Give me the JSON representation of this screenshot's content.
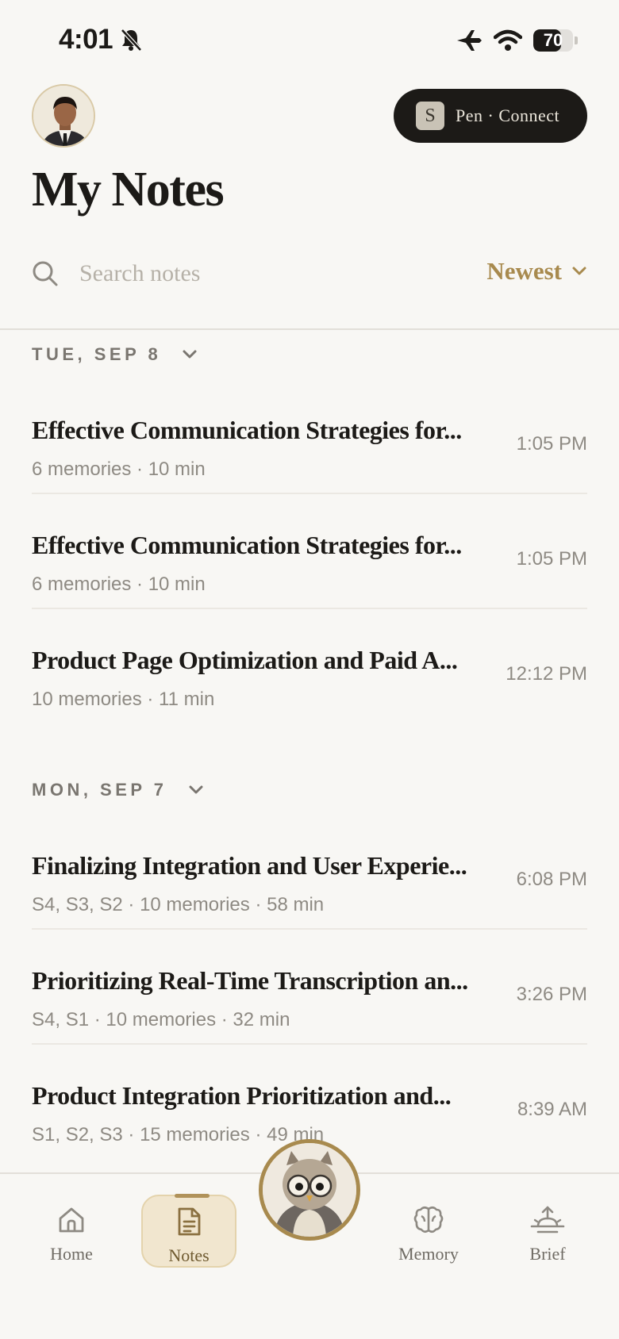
{
  "status_bar": {
    "time": "4:01",
    "battery": "70",
    "battery_level": 0.7
  },
  "header": {
    "pen_badge": "S",
    "pen_label": "Pen · Connect",
    "title": "My Notes"
  },
  "search": {
    "placeholder": "Search notes",
    "value": "",
    "sort_label": "Newest"
  },
  "groups": [
    {
      "date": "TUE, SEP 8",
      "notes": [
        {
          "title": "Effective Communication Strategies for...",
          "meta": "6 memories · 10 min",
          "time": "1:05 PM"
        },
        {
          "title": "Effective Communication Strategies for...",
          "meta": "6 memories · 10 min",
          "time": "1:05 PM"
        },
        {
          "title": "Product Page Optimization and Paid A...",
          "meta": "10 memories · 11 min",
          "time": "12:12 PM"
        }
      ]
    },
    {
      "date": "MON, SEP 7",
      "notes": [
        {
          "title": "Finalizing Integration and User Experie...",
          "meta": "S4, S3, S2 · 10 memories · 58 min",
          "time": "6:08 PM"
        },
        {
          "title": "Prioritizing Real-Time Transcription an...",
          "meta": "S4, S1 · 10 memories · 32 min",
          "time": "3:26 PM"
        },
        {
          "title": "Product Integration Prioritization and...",
          "meta": "S1, S2, S3 · 15 memories · 49 min",
          "time": "8:39 AM"
        }
      ]
    }
  ],
  "nav": {
    "home": "Home",
    "notes": "Notes",
    "memory": "Memory",
    "brief": "Brief"
  },
  "colors": {
    "accent": "#a88a4e",
    "background": "#f8f7f4",
    "text": "#1c1a17",
    "muted": "#8e8a83"
  }
}
